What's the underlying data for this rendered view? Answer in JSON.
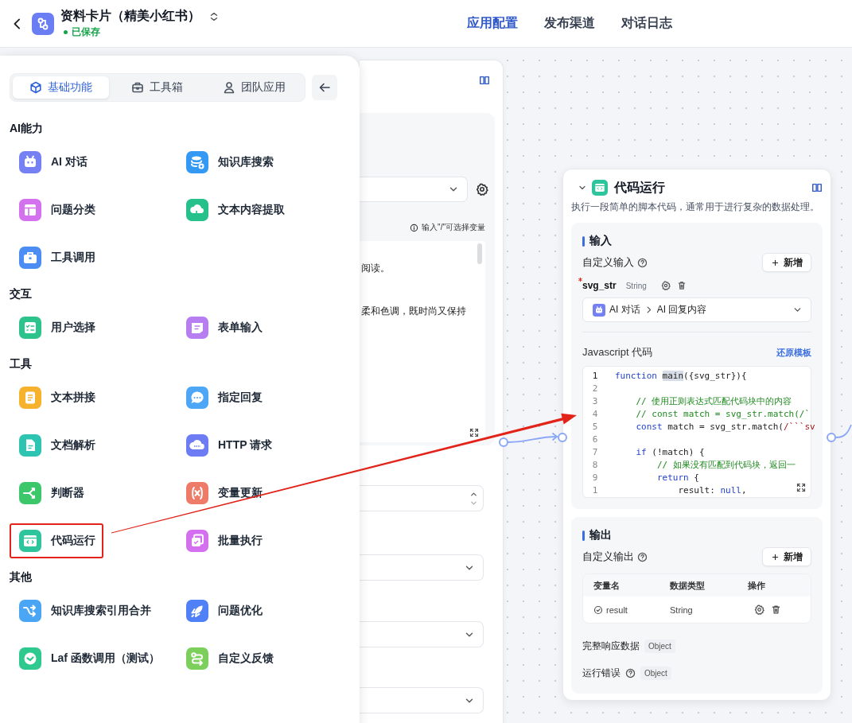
{
  "header": {
    "title": "资料卡片（精美小红书）",
    "status": "已保存",
    "tabs": [
      {
        "label": "应用配置",
        "selected": true
      },
      {
        "label": "发布渠道",
        "selected": false
      },
      {
        "label": "对话日志",
        "selected": false
      }
    ]
  },
  "node_panel": {
    "tabs": [
      {
        "label": "基础功能",
        "selected": true
      },
      {
        "label": "工具箱",
        "selected": false
      },
      {
        "label": "团队应用",
        "selected": false
      }
    ],
    "sections": [
      {
        "title": "AI能力",
        "items": [
          {
            "label": "AI 对话",
            "color": "#7480f4",
            "annotated": false
          },
          {
            "label": "知识库搜索",
            "color": "#3399f3",
            "annotated": false
          },
          {
            "label": "问题分类",
            "color": "#d371ee",
            "annotated": false
          },
          {
            "label": "文本内容提取",
            "color": "#26c08b",
            "annotated": false
          },
          {
            "label": "工具调用",
            "color": "#4b8df2",
            "annotated": false
          }
        ]
      },
      {
        "title": "交互",
        "items": [
          {
            "label": "用户选择",
            "color": "#2dc38c",
            "annotated": false
          },
          {
            "label": "表单输入",
            "color": "#b67ef0",
            "annotated": false
          }
        ]
      },
      {
        "title": "工具",
        "items": [
          {
            "label": "文本拼接",
            "color": "#f7b22d",
            "annotated": false
          },
          {
            "label": "指定回复",
            "color": "#4ea6f6",
            "annotated": false
          },
          {
            "label": "文档解析",
            "color": "#2dc5b2",
            "annotated": false
          },
          {
            "label": "HTTP 请求",
            "color": "#6e7cf3",
            "annotated": false
          },
          {
            "label": "判断器",
            "color": "#3dc76b",
            "annotated": false
          },
          {
            "label": "变量更新",
            "color": "#ee7b67",
            "annotated": false
          },
          {
            "label": "代码运行",
            "color": "#2ec59c",
            "annotated": true
          },
          {
            "label": "批量执行",
            "color": "#d46ff0",
            "annotated": false
          }
        ]
      },
      {
        "title": "其他",
        "items": [
          {
            "label": "知识库搜索引用合并",
            "color": "#4aa6f5",
            "annotated": false
          },
          {
            "label": "问题优化",
            "color": "#4f80f5",
            "annotated": false
          },
          {
            "label": "Laf 函数调用（测试）",
            "color": "#2dc98f",
            "annotated": false
          },
          {
            "label": "自定义反馈",
            "color": "#7ccf5b",
            "annotated": false
          }
        ]
      }
    ]
  },
  "prompt_node": {
    "variable_hint": "输入\"/\"可选择变量",
    "prompt_lines": [
      "阅读。",
      "柔和色调，既时尚又保持"
    ]
  },
  "code_node": {
    "title": "代码运行",
    "description": "执行一段简单的脚本代码，通常用于进行复杂的数据处理。",
    "input": {
      "heading": "输入",
      "custom_label": "自定义输入",
      "add_button": "新增",
      "variables": [
        {
          "name": "svg_str",
          "type": "String",
          "required": true,
          "source": [
            "AI 对话",
            "AI 回复内容"
          ]
        }
      ],
      "code_label": "Javascript 代码",
      "reset_link": "还原模板",
      "code_lines": [
        {
          "number": "1",
          "tokens": [
            {
              "kind": "keyword",
              "text": "function "
            },
            {
              "kind": "selection",
              "text": "main"
            },
            {
              "kind": "plain",
              "text": "({svg_str}){"
            }
          ]
        },
        {
          "number": "2"
        },
        {
          "number": "3",
          "tokens": [
            {
              "kind": "comment",
              "text": "    // 使用正则表达式匹配代码块中的内容"
            }
          ]
        },
        {
          "number": "4",
          "tokens": [
            {
              "kind": "comment",
              "text": "    // const match = svg_str.match(/`"
            }
          ]
        },
        {
          "number": "5",
          "tokens": [
            {
              "kind": "keyword",
              "text": "    const"
            },
            {
              "kind": "plain",
              "text": " match = svg_str.match("
            },
            {
              "kind": "regex",
              "text": "/```sv"
            }
          ]
        },
        {
          "number": "6"
        },
        {
          "number": "7",
          "tokens": [
            {
              "kind": "keyword",
              "text": "    if"
            },
            {
              "kind": "plain",
              "text": " (!match) {"
            }
          ]
        },
        {
          "number": "8",
          "tokens": [
            {
              "kind": "comment",
              "text": "        // 如果没有匹配到代码块，返回一"
            }
          ]
        },
        {
          "number": "9",
          "tokens": [
            {
              "kind": "keyword",
              "text": "        return"
            },
            {
              "kind": "plain",
              "text": " {"
            }
          ]
        },
        {
          "number": "1",
          "tokens": [
            {
              "kind": "plain",
              "text": "            result: "
            },
            {
              "kind": "keyword",
              "text": "null"
            },
            {
              "kind": "plain",
              "text": ","
            }
          ]
        }
      ]
    },
    "output": {
      "heading": "输出",
      "custom_label": "自定义输出",
      "add_button": "新增",
      "columns": [
        "变量名",
        "数据类型",
        "操作"
      ],
      "rows": [
        {
          "name": "result",
          "type": "String"
        }
      ],
      "fields": [
        {
          "label": "完整响应数据",
          "type": "Object",
          "help": false
        },
        {
          "label": "运行错误",
          "type": "Object",
          "help": true
        }
      ]
    }
  }
}
